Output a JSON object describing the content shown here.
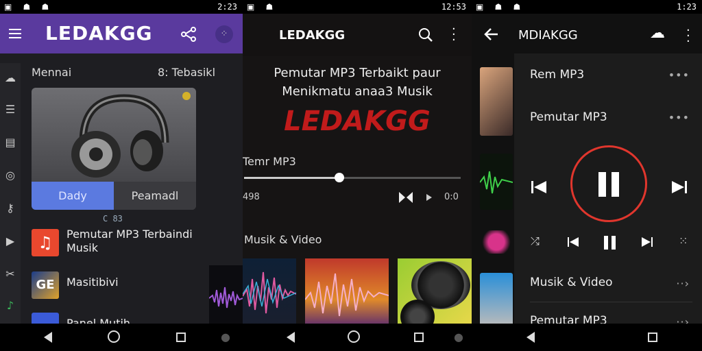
{
  "status_bar": {
    "s1_time": "2:23",
    "s2_time": "12:53",
    "s3_time": "1:23"
  },
  "screen1": {
    "app_title": "LEDAKGG",
    "section_left": "Mennai",
    "section_right": "8: Tebasikl",
    "card_button_left": "Dady",
    "card_button_right": "Peamadl",
    "card_caption": "C 83",
    "list": [
      {
        "label": "Pemutar MP3 Terbaindi Musik"
      },
      {
        "label": "Masitibivi"
      },
      {
        "label": "Panel Mutih"
      }
    ]
  },
  "screen2": {
    "app_title": "LEDAKGG",
    "headline": "Pemutar MP3 Terbaikt paur Menikmatu anaa3 Musik",
    "brand": "LEDAKGG",
    "track_label": "Temr MP3",
    "time_elapsed": "498",
    "time_end": "0:0",
    "seek_progress": 0.44,
    "section_title": "Musik & Video"
  },
  "screen3": {
    "app_title": "MDIAKGG",
    "items": [
      {
        "label": "Rem MP3"
      },
      {
        "label": "Pemutar MP3"
      }
    ],
    "bottom_items": [
      {
        "label": "Musik & Video"
      },
      {
        "label": "Pemutar MP3"
      }
    ]
  },
  "colors": {
    "purple": "#5a3a9e",
    "accent_blue": "#5b7ae0",
    "brand_red": "#c11b1b",
    "ring_red": "#e0362d"
  }
}
